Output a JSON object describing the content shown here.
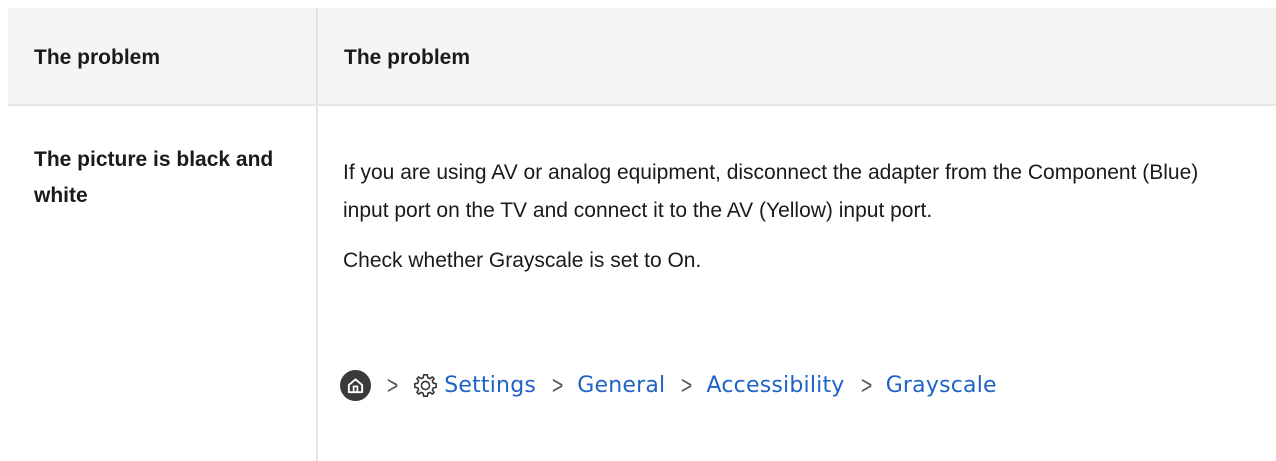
{
  "table": {
    "header": {
      "col1": "The problem",
      "col2": "The problem"
    },
    "row": {
      "problem": "The picture is black and white",
      "solution_paragraphs": [
        "If you are using AV or analog equipment, disconnect the adapter from the Component (Blue) input port on the TV and connect it to the AV (Yellow) input port.",
        "Check whether Grayscale is set to On."
      ],
      "menu_path": {
        "icons": [
          "home-icon",
          "chevron-right-icon",
          "gear-icon"
        ],
        "items": [
          "Settings",
          "General",
          "Accessibility",
          "Grayscale"
        ]
      }
    }
  },
  "colors": {
    "header_bg": "#f5f5f5",
    "border": "#e3e3e3",
    "link": "#1f63c5",
    "home_icon_bg": "#3a3a3a"
  }
}
